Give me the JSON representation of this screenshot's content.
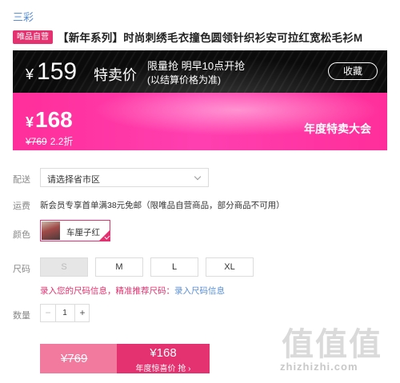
{
  "brand": "三彩",
  "badge": "唯品自营",
  "product_title": "【新年系列】时尚刺绣毛衣撞色圆领针织衫安可拉红宽松毛衫M",
  "flash_sale": {
    "currency": "¥",
    "price": "159",
    "label": "特卖价",
    "limit_line1": "限量抢 明早10点开抢",
    "limit_line2": "(以结算价格为准)",
    "favorite": "收藏"
  },
  "current": {
    "currency": "¥",
    "price": "168",
    "original": "¥769",
    "discount": "2.2折",
    "event": "年度特卖大会"
  },
  "delivery": {
    "label": "配送",
    "placeholder": "请选择省市区"
  },
  "shipping": {
    "label": "运费",
    "text": "新会员专享首单满38元免邮（限唯品自营商品，部分商品不可用）"
  },
  "color": {
    "label": "颜色",
    "option": "车厘子红"
  },
  "size": {
    "label": "尺码",
    "options": [
      "S",
      "M",
      "L",
      "XL"
    ],
    "disabled": "S",
    "hint_text": "录入您的尺码信息，精准推荐尺码：",
    "hint_link": "录入尺码信息"
  },
  "quantity": {
    "label": "数量",
    "minus": "−",
    "value": "1",
    "plus": "+"
  },
  "buy": {
    "original": "¥769",
    "price": "¥168",
    "cta": "年度惊喜价 抢 ›"
  },
  "watermark": {
    "glyphs": "值值值",
    "url": "zhizhizhi.com"
  },
  "colors": {
    "accent": "#e4316f",
    "pink_banner": "#ff2e9a",
    "link": "#5a8fd6"
  }
}
